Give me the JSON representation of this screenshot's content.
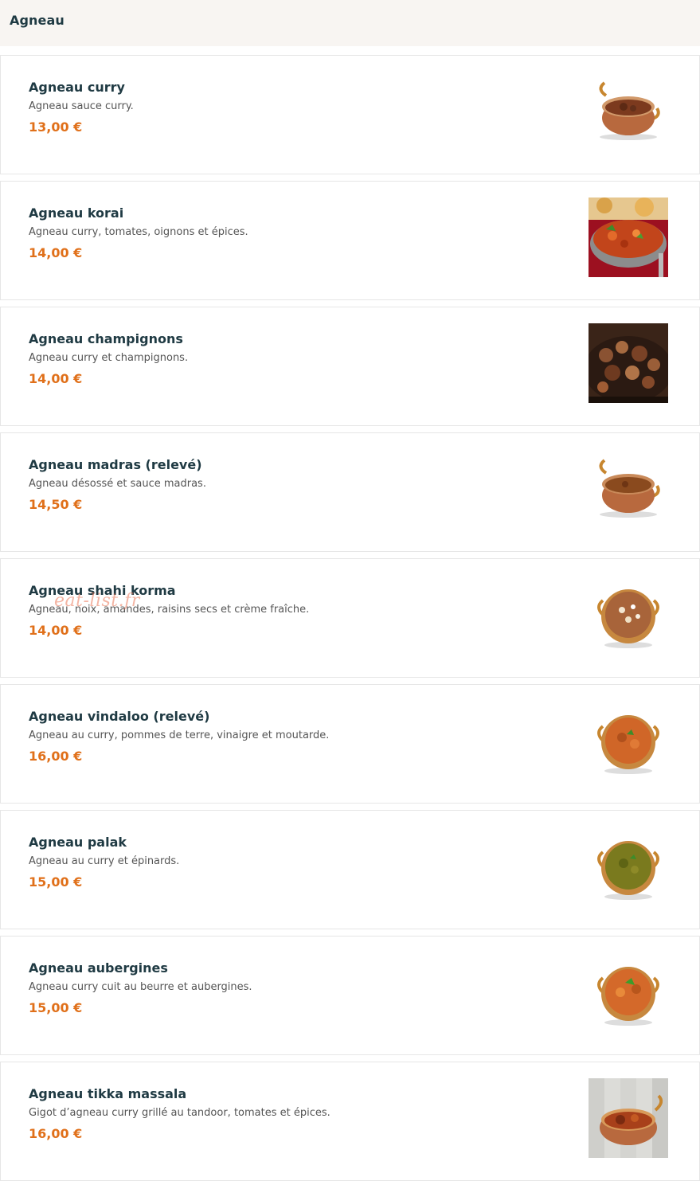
{
  "section": {
    "title": "Agneau"
  },
  "items": [
    {
      "name": "Agneau curry",
      "description": "Agneau sauce curry.",
      "price": "13,00 €",
      "image": "copper-bowl-brown-curry"
    },
    {
      "name": "Agneau korai",
      "description": "Agneau curry, tomates, oignons et épices.",
      "price": "14,00 €",
      "image": "karahi-red-curry-photo"
    },
    {
      "name": "Agneau champignons",
      "description": "Agneau curry et champignons.",
      "price": "14,00 €",
      "image": "mushroom-lamb-photo"
    },
    {
      "name": "Agneau madras (relevé)",
      "description": "Agneau désossé et sauce madras.",
      "price": "14,50 €",
      "image": "copper-bowl-brown-curry"
    },
    {
      "name": "Agneau shahi korma",
      "description": "Agneau, noix, amandes, raisins secs et crème fraîche.",
      "price": "14,00 €",
      "image": "copper-bowl-korma"
    },
    {
      "name": "Agneau vindaloo (relevé)",
      "description": "Agneau au curry, pommes de terre, vinaigre et moutarde.",
      "price": "16,00 €",
      "image": "copper-bowl-orange-curry"
    },
    {
      "name": "Agneau palak",
      "description": "Agneau au curry et épinards.",
      "price": "15,00 €",
      "image": "copper-bowl-green-curry"
    },
    {
      "name": "Agneau aubergines",
      "description": "Agneau curry cuit au beurre et aubergines.",
      "price": "15,00 €",
      "image": "copper-bowl-orange-curry"
    },
    {
      "name": "Agneau tikka massala",
      "description": "Gigot d’agneau curry grillé au tandoor, tomates et épices.",
      "price": "16,00 €",
      "image": "tikka-masala-photo"
    }
  ],
  "watermark": "eat-list.fr",
  "colors": {
    "title": "#1f3a43",
    "price": "#e0701a",
    "header_bg": "#f8f5f2",
    "border": "#e6e6e6"
  }
}
